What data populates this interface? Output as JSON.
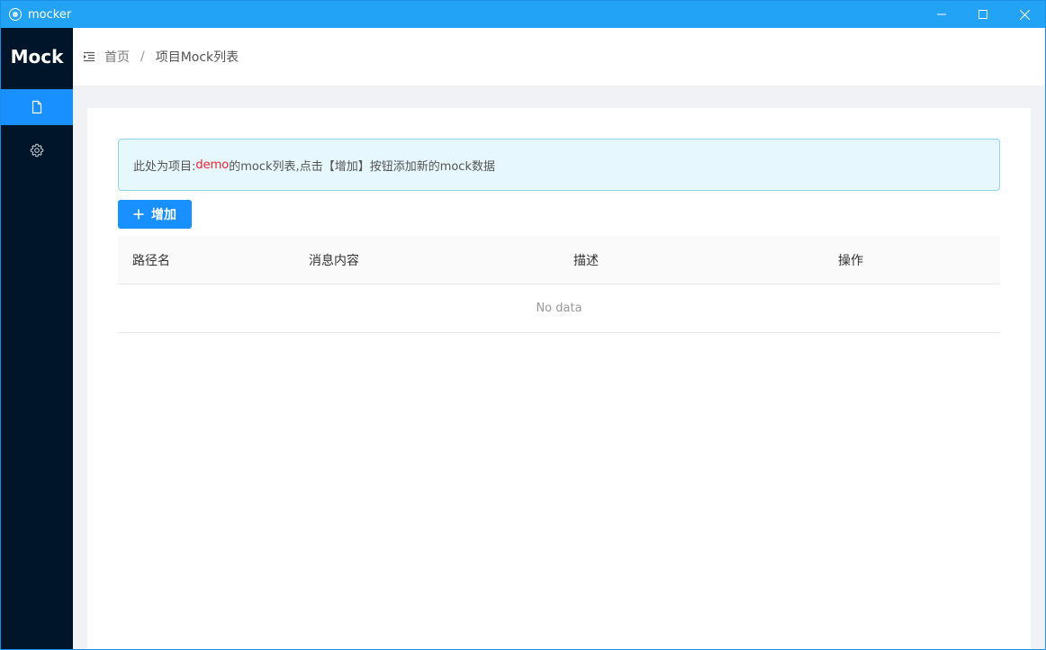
{
  "window": {
    "title": "mocker"
  },
  "sidebar": {
    "logo": "Mock",
    "items": [
      {
        "icon": "file-icon",
        "active": true
      },
      {
        "icon": "gear-icon",
        "active": false
      }
    ]
  },
  "header": {
    "breadcrumb": [
      "首页",
      "/",
      "项目Mock列表"
    ]
  },
  "alert": {
    "prefix": "此处为项目:",
    "project": "demo",
    "suffix": "的mock列表,点击【增加】按钮添加新的mock数据"
  },
  "toolbar": {
    "add_label": "增加"
  },
  "table": {
    "columns": [
      "路径名",
      "消息内容",
      "描述",
      "操作"
    ],
    "empty_text": "No data"
  },
  "colors": {
    "titlebar": "#22a3f5",
    "sidebar": "#001529",
    "primary": "#1890ff",
    "highlight": "#f5222d"
  }
}
